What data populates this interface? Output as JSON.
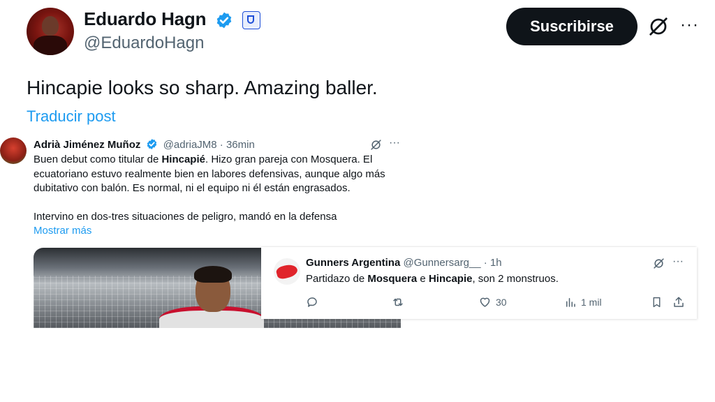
{
  "main_post": {
    "author_name": "Eduardo Hagn",
    "author_handle": "@EduardoHagn",
    "subscribe_label": "Suscribirse",
    "more_label": "···",
    "text": "Hincapie looks so sharp. Amazing baller.",
    "translate_label": "Traducir post"
  },
  "quote1": {
    "author_name": "Adrià Jiménez Muñoz",
    "author_handle": "@adriaJM8",
    "separator": " · ",
    "time": "36min",
    "more_label": "···",
    "body": {
      "line1_pre": "Buen debut como titular de ",
      "line1_bold": "Hincapié",
      "line1_post": ". Hizo gran pareja con Mosquera. El ecuatoriano estuvo realmente bien en labores defensivas, aunque algo más dubitativo con balón. Es normal, ni el equipo ni él están engrasados.",
      "line2": "Intervino en dos-tres situaciones de peligro, mandó en la defensa"
    },
    "show_more_label": "Mostrar más"
  },
  "quote2": {
    "author_name": "Gunners Argentina",
    "author_handle": "@Gunnersarg__",
    "separator": " · ",
    "time": "1h",
    "more_label": "···",
    "body": {
      "t1": "Partidazo de ",
      "b1": "Mosquera",
      "t2": " e ",
      "b2": "Hincapie",
      "t3": ", son 2 monstruos."
    },
    "actions": {
      "likes": "30",
      "views": "1 mil"
    }
  },
  "colors": {
    "link": "#1d9bf0",
    "text": "#0f1419",
    "muted": "#536471",
    "button_bg": "#0f1419"
  }
}
